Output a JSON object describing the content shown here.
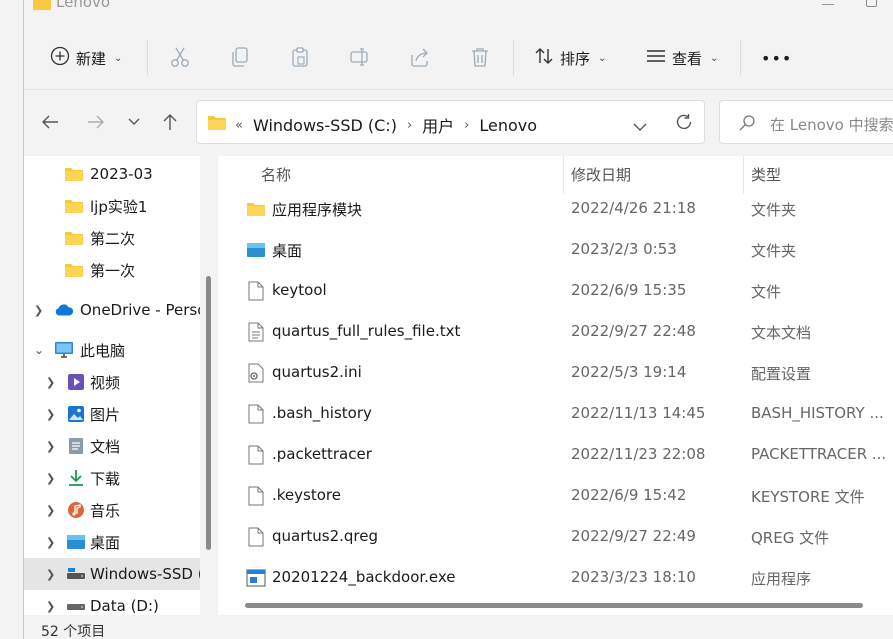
{
  "window": {
    "title": "Lenovo"
  },
  "toolbar": {
    "new_label": "新建",
    "sort_label": "排序",
    "view_label": "查看",
    "more_label": "•••"
  },
  "address": {
    "overflow": "«",
    "crumbs": [
      "Windows-SSD (C:)",
      "用户",
      "Lenovo"
    ]
  },
  "search": {
    "placeholder": "在 Lenovo 中搜索"
  },
  "sidebar": {
    "items": [
      {
        "label": "2023-03",
        "icon": "folder-icon"
      },
      {
        "label": "ljp实验1",
        "icon": "folder-icon"
      },
      {
        "label": "第二次",
        "icon": "folder-icon"
      },
      {
        "label": "第一次",
        "icon": "folder-icon"
      },
      {
        "label": "OneDrive - Perso",
        "icon": "onedrive-icon"
      },
      {
        "label": "此电脑",
        "icon": "this-pc-icon"
      },
      {
        "label": "视频",
        "icon": "videos-icon"
      },
      {
        "label": "图片",
        "icon": "pictures-icon"
      },
      {
        "label": "文档",
        "icon": "documents-icon"
      },
      {
        "label": "下载",
        "icon": "downloads-icon"
      },
      {
        "label": "音乐",
        "icon": "music-icon"
      },
      {
        "label": "桌面",
        "icon": "desktop-icon"
      },
      {
        "label": "Windows-SSD (",
        "icon": "drive-icon"
      },
      {
        "label": "Data (D:)",
        "icon": "drive-icon"
      }
    ]
  },
  "columns": {
    "name": "名称",
    "modified": "修改日期",
    "type": "类型"
  },
  "files": [
    {
      "name": "应用程序模块",
      "date": "2022/4/26 21:18",
      "type": "文件夹",
      "icon": "folder-icon"
    },
    {
      "name": "桌面",
      "date": "2023/2/3 0:53",
      "type": "文件夹",
      "icon": "desktop-folder-icon"
    },
    {
      "name": "keytool",
      "date": "2022/6/9 15:35",
      "type": "文件",
      "icon": "file-icon"
    },
    {
      "name": "quartus_full_rules_file.txt",
      "date": "2022/9/27 22:48",
      "type": "文本文档",
      "icon": "text-file-icon"
    },
    {
      "name": "quartus2.ini",
      "date": "2022/5/3 19:14",
      "type": "配置设置",
      "icon": "config-file-icon"
    },
    {
      "name": ".bash_history",
      "date": "2022/11/13 14:45",
      "type": "BASH_HISTORY ...",
      "icon": "file-icon"
    },
    {
      "name": ".packettracer",
      "date": "2022/11/23 22:08",
      "type": "PACKETTRACER ...",
      "icon": "file-icon"
    },
    {
      "name": ".keystore",
      "date": "2022/6/9 15:42",
      "type": "KEYSTORE 文件",
      "icon": "file-icon"
    },
    {
      "name": "quartus2.qreg",
      "date": "2022/9/27 22:49",
      "type": "QREG 文件",
      "icon": "file-icon"
    },
    {
      "name": "20201224_backdoor.exe",
      "date": "2023/3/23 18:10",
      "type": "应用程序",
      "icon": "exe-icon"
    }
  ],
  "status": {
    "item_count": "52 个项目"
  },
  "colors": {
    "folder": "#f8c93f",
    "accent": "#0067c0",
    "selected": "#e5e5e5"
  }
}
